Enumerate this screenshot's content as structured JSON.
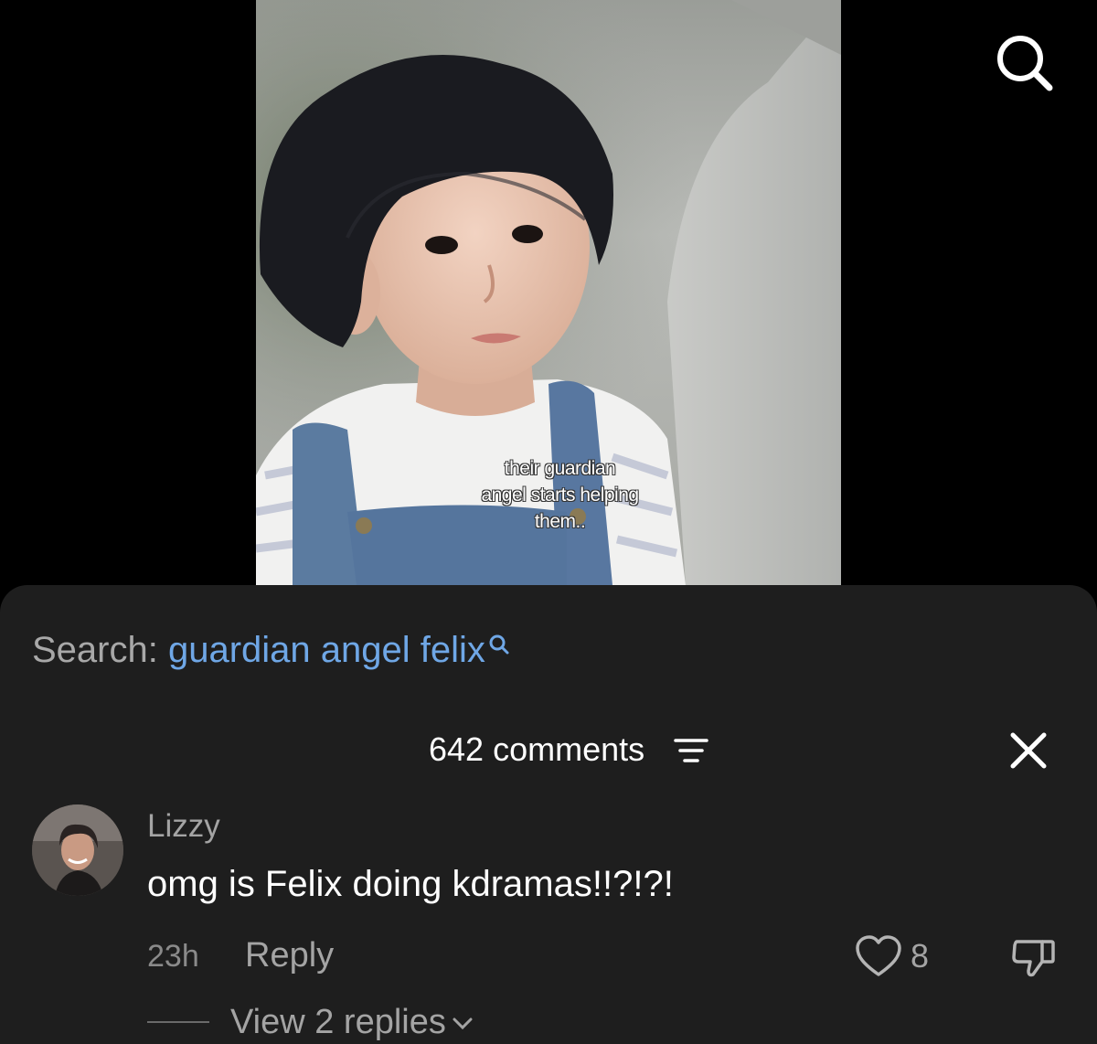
{
  "video": {
    "caption_lines": [
      "their guardian",
      "angel starts helping",
      "them.."
    ]
  },
  "top_search": {
    "icon": "search-icon"
  },
  "search_suggestion": {
    "prefix": "Search:",
    "term": "guardian angel felix",
    "icon": "search-icon"
  },
  "comments_header": {
    "count_label": "642 comments",
    "sort_icon": "sort-icon",
    "close_icon": "close-icon"
  },
  "comments": [
    {
      "username": "Lizzy",
      "text": "omg is Felix doing kdramas!!?!?!",
      "time": "23h",
      "reply_label": "Reply",
      "likes": "8",
      "view_replies_label": "View 2 replies"
    }
  ],
  "colors": {
    "background": "#000000",
    "sheet": "#1e1e1e",
    "link_blue": "#6fa7e6",
    "muted_text": "#a4a4a4",
    "primary_text": "#ffffff"
  }
}
